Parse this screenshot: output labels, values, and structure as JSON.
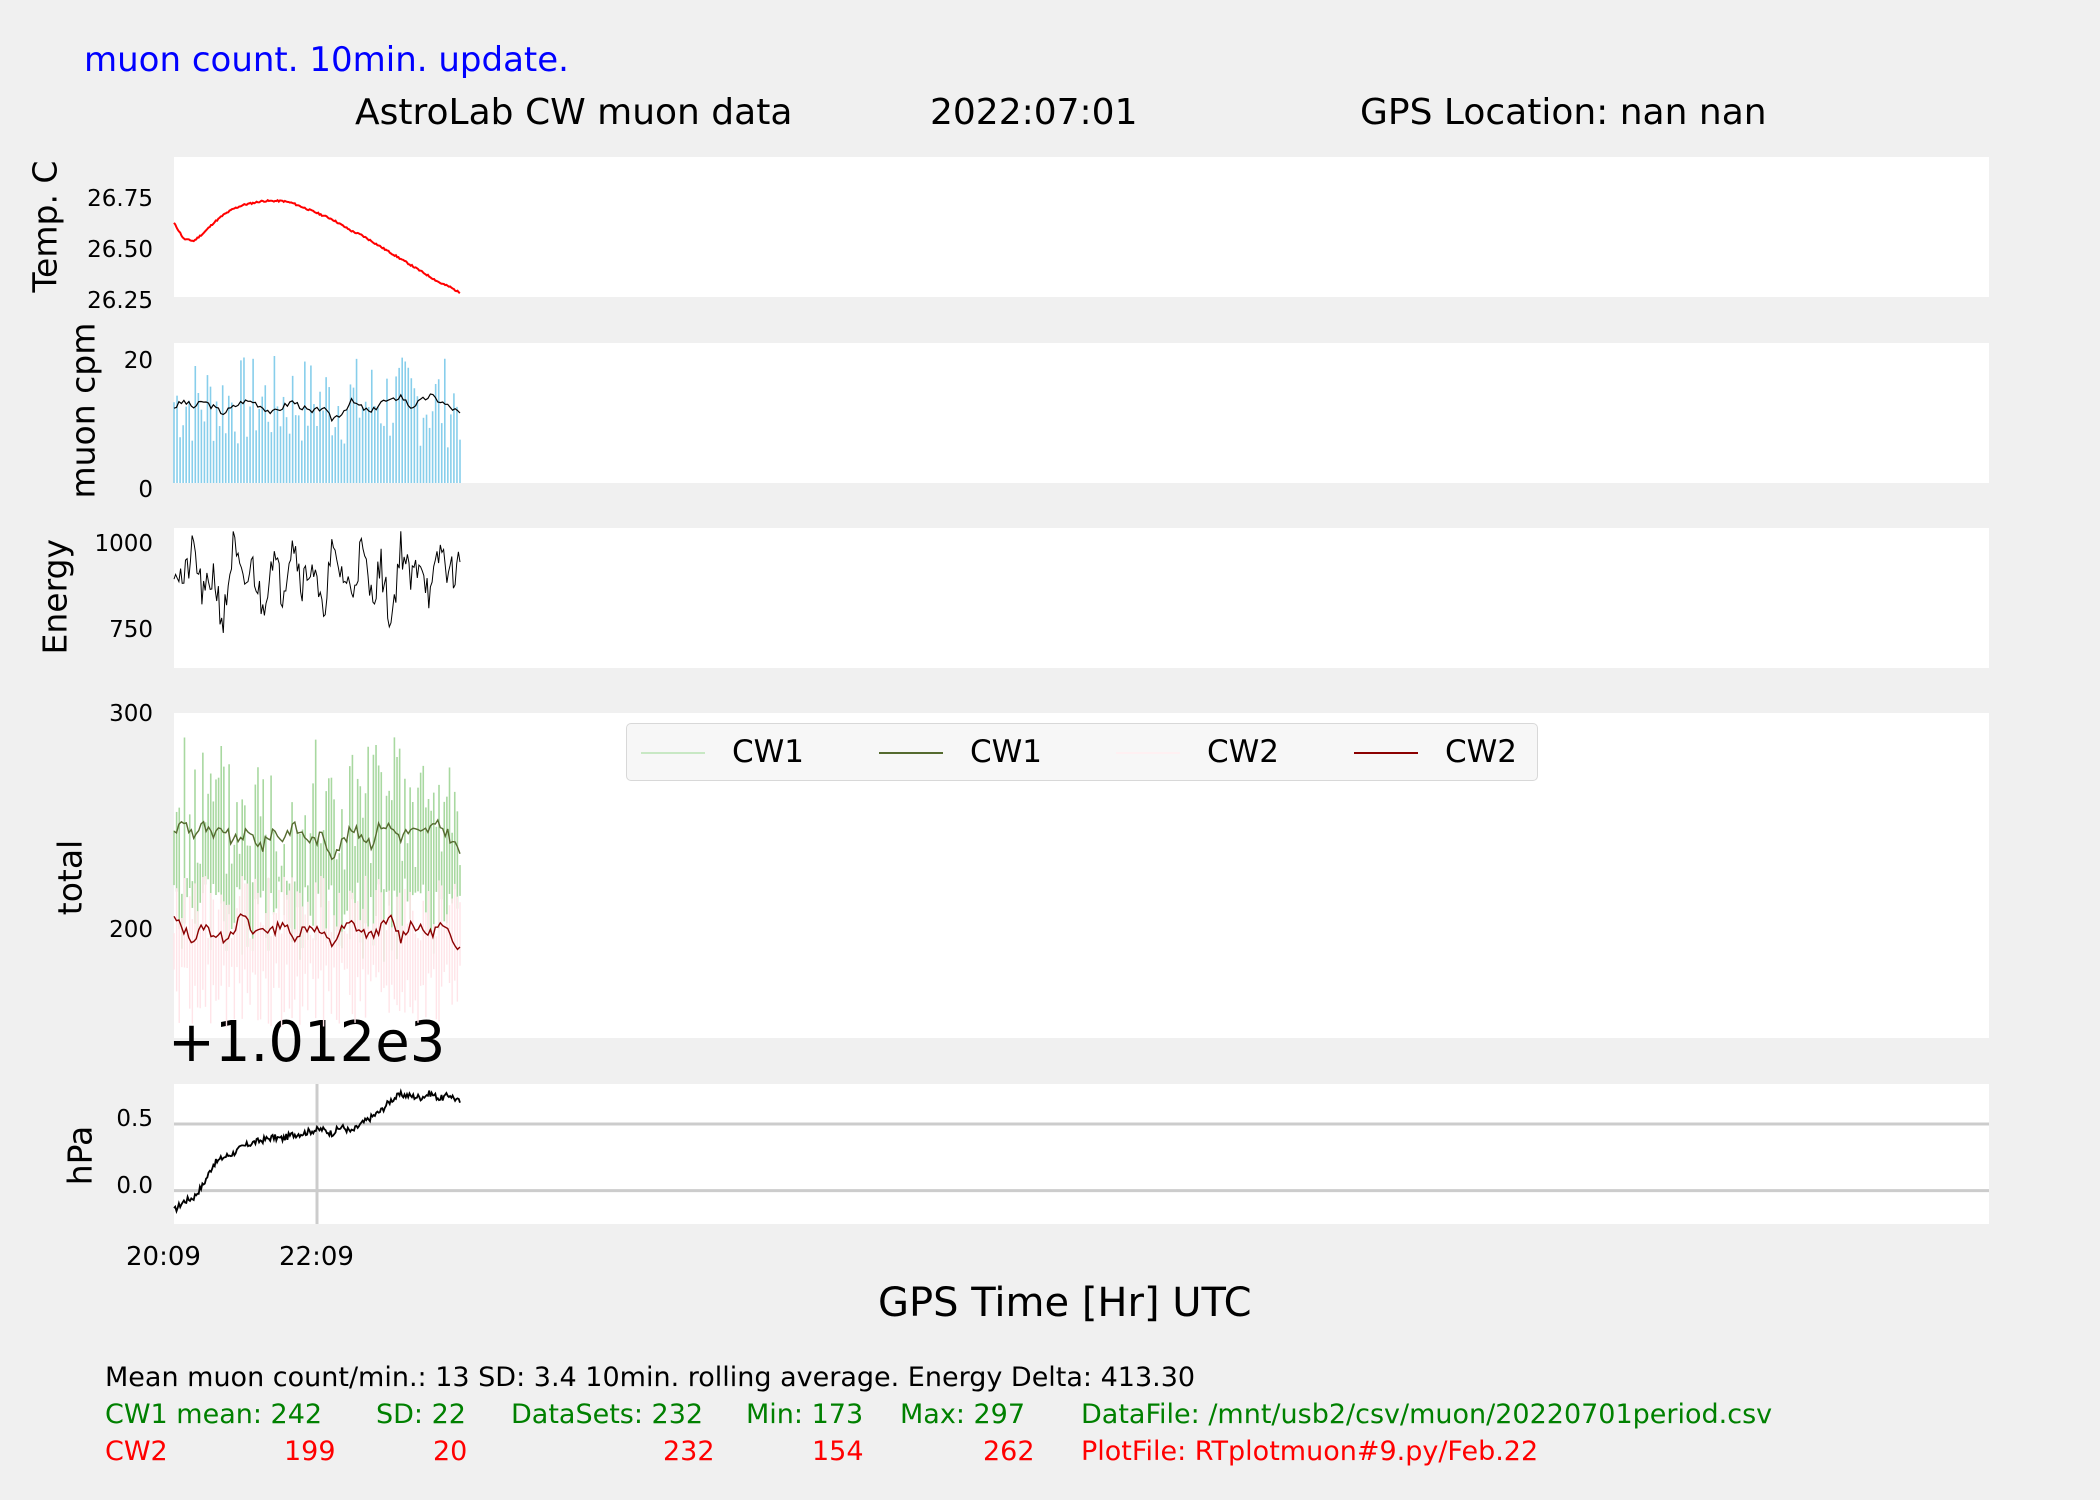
{
  "header": {
    "subtitle": "muon count.  10min. update.",
    "title": "AstroLab CW muon data",
    "date": "2022:07:01",
    "gps_location": "GPS Location: nan   nan"
  },
  "colors": {
    "temp": "#ff0000",
    "muon_bars": "#87ceeb",
    "cw1_raw": "#a8d8a0",
    "cw1_avg": "#556b2f",
    "cw2_raw": "#ffe4e8",
    "cw2_avg": "#8b0000",
    "grid": "#cccccc"
  },
  "chart_data": [
    {
      "type": "line",
      "ylabel": "Temp. C",
      "yticks": [
        "26.75",
        "26.50",
        "26.25"
      ],
      "ylim": [
        26.25,
        26.95
      ],
      "series": [
        {
          "values": [
            26.62,
            26.54,
            26.53,
            26.57,
            26.62,
            26.66,
            26.69,
            26.71,
            26.72,
            26.73,
            26.73,
            26.73,
            26.72,
            26.7,
            26.68,
            26.66,
            26.64,
            26.61,
            26.58,
            26.56,
            26.53,
            26.5,
            26.47,
            26.44,
            26.41,
            26.38,
            26.35,
            26.32,
            26.3,
            26.27
          ]
        }
      ]
    },
    {
      "type": "bar",
      "ylabel": "muon cpm",
      "yticks": [
        "20",
        "0"
      ],
      "ylim": [
        0,
        24
      ],
      "series": [
        {
          "name": "rolling average",
          "values": [
            13,
            14,
            13,
            14,
            13,
            12,
            13,
            14,
            14,
            13,
            12,
            13,
            14,
            13,
            12,
            13,
            11,
            12,
            14,
            13,
            12,
            14,
            14,
            15,
            13,
            14,
            15,
            14,
            13,
            12
          ]
        }
      ]
    },
    {
      "type": "line",
      "ylabel": "Energy",
      "yticks": [
        "1000",
        "750"
      ],
      "ylim": [
        650,
        1060
      ],
      "series": [
        {
          "values": [
            960,
            900,
            1000,
            850,
            930,
            780,
            1010,
            880,
            950,
            820,
            990,
            870,
            1040,
            900,
            960,
            800,
            980,
            930,
            870,
            1000,
            860,
            950,
            780,
            1010,
            900,
            980,
            850,
            1000,
            920,
            960
          ]
        }
      ]
    },
    {
      "type": "line",
      "ylabel": "total",
      "yticks": [
        "300",
        "200"
      ],
      "ylim": [
        150,
        300
      ],
      "legend": [
        "CW1",
        "CW1",
        "CW2",
        "CW2"
      ],
      "series": [
        {
          "name": "CW1",
          "values": [
            240,
            265,
            215,
            258,
            225,
            270,
            210,
            250,
            262,
            218,
            272,
            230,
            255,
            212,
            266,
            238,
            280,
            220,
            248,
            260,
            215,
            275,
            230,
            252,
            268,
            222,
            258,
            286,
            235,
            245
          ]
        },
        {
          "name": "CW1",
          "values": [
            245,
            250,
            244,
            248,
            242,
            247,
            240,
            244,
            243,
            238,
            246,
            242,
            248,
            244,
            241,
            243,
            235,
            240,
            246,
            244,
            240,
            249,
            247,
            243,
            246,
            244,
            247,
            248,
            243,
            235
          ]
        },
        {
          "name": "CW2",
          "values": [
            195,
            210,
            180,
            205,
            175,
            212,
            185,
            200,
            170,
            208,
            190,
            215,
            178,
            202,
            195,
            188,
            168,
            210,
            192,
            205,
            176,
            200,
            214,
            186,
            198,
            204,
            180,
            210,
            192,
            185
          ]
        },
        {
          "name": "CW2",
          "values": [
            205,
            200,
            195,
            202,
            198,
            196,
            200,
            207,
            198,
            201,
            199,
            204,
            196,
            200,
            202,
            198,
            193,
            200,
            203,
            199,
            197,
            201,
            205,
            196,
            203,
            200,
            198,
            202,
            197,
            192
          ]
        }
      ]
    },
    {
      "type": "line",
      "ylabel": "hPa",
      "offset_label": "+1.012e3",
      "yticks": [
        "0.5",
        "0.0"
      ],
      "ylim": [
        -0.25,
        0.8
      ],
      "xticks": [
        "20:09",
        "22:09"
      ],
      "xlabel": "GPS Time  [Hr] UTC",
      "series": [
        {
          "values": [
            -0.15,
            -0.08,
            -0.05,
            0.05,
            0.2,
            0.25,
            0.28,
            0.33,
            0.36,
            0.38,
            0.4,
            0.39,
            0.42,
            0.43,
            0.45,
            0.46,
            0.43,
            0.48,
            0.44,
            0.5,
            0.55,
            0.6,
            0.68,
            0.72,
            0.71,
            0.7,
            0.73,
            0.69,
            0.72,
            0.66
          ]
        }
      ]
    }
  ],
  "stats": {
    "line1": "Mean muon count/min.: 13  SD: 3.4   10min. rolling average.    Energy Delta:  413.30",
    "cw1_label": "CW1 mean: 242",
    "cw1_sd": "SD: 22",
    "cw1_datasets": "DataSets: 232",
    "cw1_min": "Min: 173",
    "cw1_max": "Max: 297",
    "datafile": "DataFile: /mnt/usb2/csv/muon/20220701period.csv",
    "cw2_label": "CW2",
    "cw2_mean": "199",
    "cw2_sd": "20",
    "cw2_datasets": "232",
    "cw2_min": "154",
    "cw2_max": "262",
    "plotfile": "PlotFile: RTplotmuon#9.py/Feb.22"
  }
}
